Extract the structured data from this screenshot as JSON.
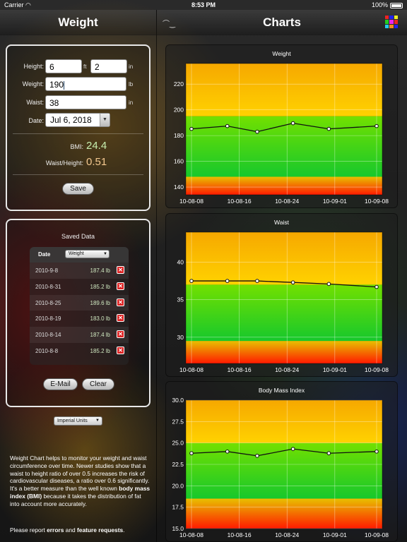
{
  "status": {
    "carrier": "Carrier",
    "time": "8:53 PM",
    "battery": "100%"
  },
  "left_title": "Weight",
  "right_title": "Charts",
  "form": {
    "height_label": "Height:",
    "height_ft": "6",
    "ft_unit": "ft",
    "height_in": "2",
    "in_unit": "in",
    "weight_label": "Weight:",
    "weight": "190",
    "weight_unit": "lb",
    "waist_label": "Waist:",
    "waist": "38",
    "waist_unit": "in",
    "date_label": "Date:",
    "date": "Jul 6, 2018"
  },
  "stats": {
    "bmi_label": "BMI:",
    "bmi": "24.4",
    "wh_label": "Waist/Height:",
    "wh": "0.51"
  },
  "save_label": "Save",
  "saved": {
    "title": "Saved Data",
    "date_header": "Date",
    "metric": "Weight",
    "rows": [
      {
        "date": "2010-9-8",
        "value": "187.4 lb"
      },
      {
        "date": "2010-8-31",
        "value": "185.2 lb"
      },
      {
        "date": "2010-8-25",
        "value": "189.6 lb"
      },
      {
        "date": "2010-8-19",
        "value": "183.0 lb"
      },
      {
        "date": "2010-8-14",
        "value": "187.4 lb"
      },
      {
        "date": "2010-8-8",
        "value": "185.2 lb"
      }
    ],
    "email_label": "E-Mail",
    "clear_label": "Clear"
  },
  "units": "Imperial Units",
  "info": {
    "p1_a": "Weight Chart helps to monitor your weight and waist circumference over time. Newer studies show that a waist to height ratio of over 0.5 increases the risk of cardiovascular diseases, a ratio over 0.6 significantly. It's a better measure than the well known ",
    "p1_b": "body mass index (BMI)",
    "p1_c": " because it takes the distribution of fat into account more accurately.",
    "p2_a": "Please report ",
    "p2_b": "errors",
    "p2_c": " and ",
    "p2_d": "feature requests",
    "p2_e": "."
  },
  "colors": {
    "bmi": "#c8f0b0",
    "wh": "#f4c890"
  },
  "chart_data": [
    {
      "type": "line",
      "title": "Weight",
      "x": [
        "10-08-08",
        "10-08-14",
        "10-08-19",
        "10-08-25",
        "10-08-31",
        "10-09-08"
      ],
      "xticks": [
        "10-08-08",
        "10-08-16",
        "10-08-24",
        "10-09-01",
        "10-09-08"
      ],
      "values": [
        185.2,
        187.4,
        183.0,
        189.6,
        185.2,
        187.4
      ],
      "ylim": [
        134,
        236
      ],
      "yticks": [
        140,
        160,
        180,
        200,
        220
      ],
      "bands": {
        "red": [
          134,
          148
        ],
        "green": [
          148,
          195
        ],
        "yellow": [
          195,
          236
        ]
      }
    },
    {
      "type": "line",
      "title": "Waist",
      "x": [
        "10-08-08",
        "10-08-14",
        "10-08-19",
        "10-08-25",
        "10-08-31",
        "10-09-08"
      ],
      "xticks": [
        "10-08-08",
        "10-08-16",
        "10-08-24",
        "10-09-01",
        "10-09-08"
      ],
      "values": [
        37.5,
        37.5,
        37.5,
        37.3,
        37.1,
        36.7
      ],
      "ylim": [
        26.5,
        44
      ],
      "yticks": [
        30,
        35,
        40
      ],
      "bands": {
        "red": [
          26.5,
          29.5
        ],
        "green": [
          29.5,
          37
        ],
        "yellow": [
          37,
          44
        ]
      }
    },
    {
      "type": "line",
      "title": "Body Mass Index",
      "x": [
        "10-08-08",
        "10-08-14",
        "10-08-19",
        "10-08-25",
        "10-08-31",
        "10-09-08"
      ],
      "xticks": [
        "10-08-08",
        "10-08-16",
        "10-08-24",
        "10-09-01",
        "10-09-08"
      ],
      "values": [
        23.8,
        24.0,
        23.5,
        24.3,
        23.8,
        24.0
      ],
      "ylim": [
        15,
        30
      ],
      "yticks": [
        15.0,
        17.5,
        20.0,
        22.5,
        25.0,
        27.5,
        30.0
      ],
      "bands": {
        "red": [
          15,
          18.5
        ],
        "green": [
          18.5,
          25
        ],
        "yellow": [
          25,
          30
        ]
      }
    }
  ]
}
